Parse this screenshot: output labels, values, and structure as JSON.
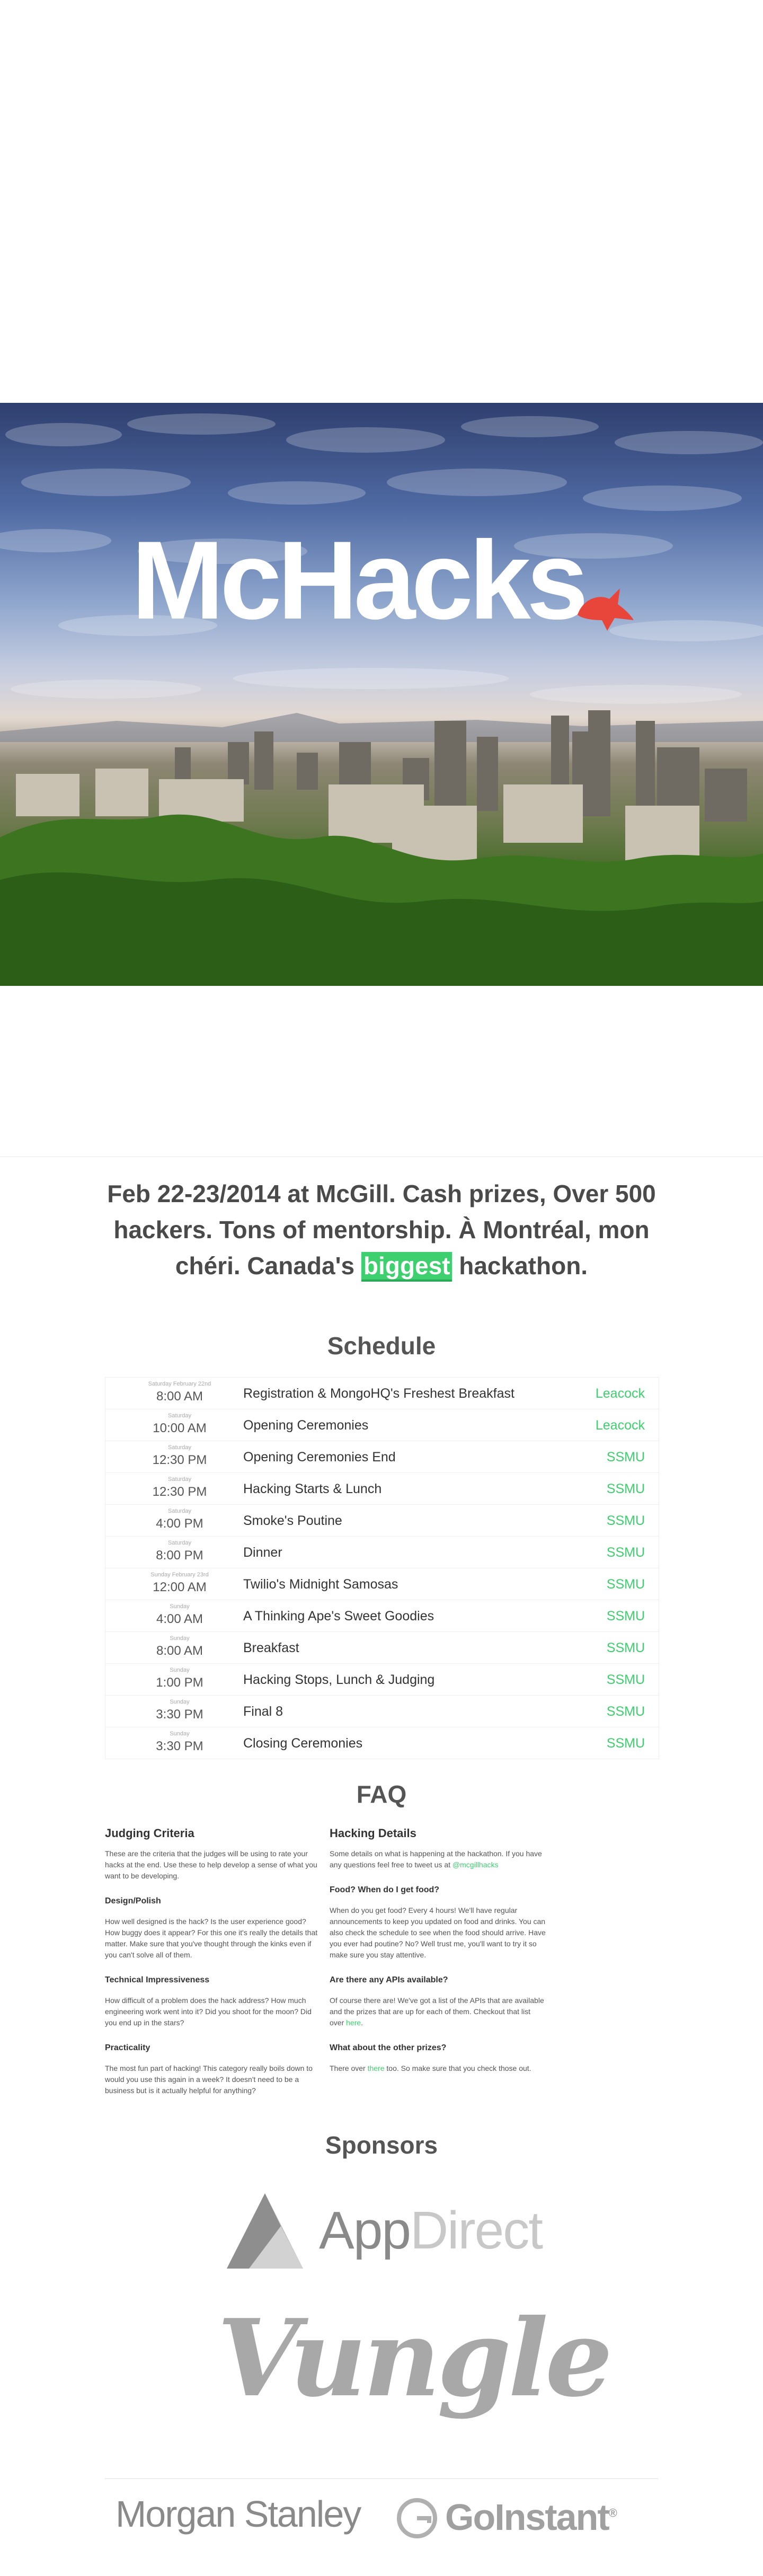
{
  "hero": {
    "logo_text": "McHacks"
  },
  "tagline": {
    "part1": "Feb 22-23/2014 at McGill. Cash prizes, Over 500 hackers. Tons of mentorship. À Montréal, mon chéri. Canada's ",
    "highlight": "biggest",
    "part2": " hackathon."
  },
  "schedule": {
    "title": "Schedule",
    "rows": [
      {
        "day": "Saturday February 22nd",
        "time": "8:00 AM",
        "event": "Registration & MongoHQ's Freshest Breakfast",
        "location": "Leacock"
      },
      {
        "day": "Saturday",
        "time": "10:00 AM",
        "event": "Opening Ceremonies",
        "location": "Leacock"
      },
      {
        "day": "Saturday",
        "time": "12:30 PM",
        "event": "Opening Ceremonies End",
        "location": "SSMU"
      },
      {
        "day": "Saturday",
        "time": "12:30 PM",
        "event": "Hacking Starts & Lunch",
        "location": "SSMU"
      },
      {
        "day": "Saturday",
        "time": "4:00 PM",
        "event": "Smoke's Poutine",
        "location": "SSMU"
      },
      {
        "day": "Saturday",
        "time": "8:00 PM",
        "event": "Dinner",
        "location": "SSMU"
      },
      {
        "day": "Sunday February 23rd",
        "time": "12:00 AM",
        "event": "Twilio's Midnight Samosas",
        "location": "SSMU"
      },
      {
        "day": "Sunday",
        "time": "4:00 AM",
        "event": "A Thinking Ape's Sweet Goodies",
        "location": "SSMU"
      },
      {
        "day": "Sunday",
        "time": "8:00 AM",
        "event": "Breakfast",
        "location": "SSMU"
      },
      {
        "day": "Sunday",
        "time": "1:00 PM",
        "event": "Hacking Stops, Lunch & Judging",
        "location": "SSMU"
      },
      {
        "day": "Sunday",
        "time": "3:30 PM",
        "event": "Final 8",
        "location": "SSMU"
      },
      {
        "day": "Sunday",
        "time": "3:30 PM",
        "event": "Closing Ceremonies",
        "location": "SSMU"
      }
    ]
  },
  "faq": {
    "title": "FAQ",
    "left": {
      "heading": "Judging Criteria",
      "intro": "These are the criteria that the judges will be using to rate your hacks at the end. Use these to help develop a sense of what you want to be developing.",
      "items": [
        {
          "q": "Design/Polish",
          "a": "How well designed is the hack? Is the user experience good? How buggy does it appear? For this one it's really the details that matter. Make sure that you've thought through the kinks even if you can't solve all of them."
        },
        {
          "q": "Technical Impressiveness",
          "a": "How difficult of a problem does the hack address? How much engineering work went into it? Did you shoot for the moon? Did you end up in the stars?"
        },
        {
          "q": "Practicality",
          "a": "The most fun part of hacking! This category really boils down to would you use this again in a week? It doesn't need to be a business but is it actually helpful for anything?"
        }
      ]
    },
    "right": {
      "heading": "Hacking Details",
      "intro_pre": "Some details on what is happening at the hackathon. If you have any questions feel free to tweet us at ",
      "intro_link": "@mcgillhacks",
      "food_q": "Food? When do I get food?",
      "food_a": "When do you get food? Every 4 hours! We'll have regular announcements to keep you updated on food and drinks. You can also check the schedule to see when the food should arrive. Have you ever had poutine? No? Well trust me, you'll want to try it so make sure you stay attentive.",
      "api_q": "Are there any APIs available?",
      "api_a_pre": "Of course there are! We've got a list of the APIs that are available and the prizes that are up for each of them. Checkout that list over ",
      "api_link": "here",
      "api_a_post": ".",
      "prize_q": "What about the other prizes?",
      "prize_a_pre": "There over ",
      "prize_link": "there",
      "prize_a_post": " too. So make sure that you check those out."
    }
  },
  "sponsors": {
    "title": "Sponsors",
    "appdirect_app": "App",
    "appdirect_direct": "Direct",
    "vungle": "Vungle",
    "morgan": "Morgan Stanley",
    "goinstant": "GoInstant",
    "registered": "®"
  },
  "colors": {
    "accent": "#3ecf6e",
    "logo_bird": "#e8463a"
  }
}
